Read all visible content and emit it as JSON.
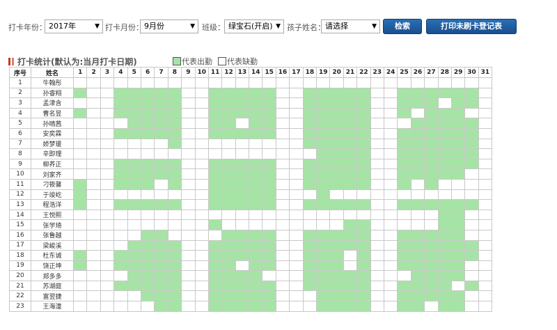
{
  "filters": {
    "year_label": "打卡年份：",
    "year_value": "2017年",
    "month_label": "打卡月份：",
    "month_value": "9月份",
    "class_label": "班级：",
    "class_value": "绿宝石(开启)",
    "child_label": "孩子姓名：",
    "child_value": "请选择",
    "search_button": "检索",
    "print_button": "打印未刷卡登记表",
    "dropdown_icon": "▼"
  },
  "section": {
    "title": "打卡统计(默认为:当月打卡日期)",
    "legend_present": "代表出勤",
    "legend_absent": "代表缺勤"
  },
  "colors": {
    "present": "#a6e4a6",
    "absent": "#ffffff",
    "button": "#1f5c9e",
    "title_accent": "#c0392b"
  },
  "table": {
    "col_index": "序号",
    "col_name": "姓名",
    "days": [
      "1",
      "2",
      "3",
      "4",
      "5",
      "6",
      "7",
      "8",
      "9",
      "10",
      "11",
      "12",
      "13",
      "14",
      "15",
      "16",
      "17",
      "18",
      "19",
      "20",
      "21",
      "22",
      "23",
      "24",
      "25",
      "26",
      "27",
      "28",
      "29",
      "30",
      "31"
    ],
    "rows": [
      {
        "no": "1",
        "name": "牛翰彤",
        "att": []
      },
      {
        "no": "2",
        "name": "孙睿翔",
        "att": [
          1,
          4,
          5,
          6,
          7,
          8,
          11,
          12,
          13,
          14,
          15,
          18,
          19,
          20,
          21,
          22,
          25,
          26,
          27,
          28,
          29,
          30
        ]
      },
      {
        "no": "3",
        "name": "孟津含",
        "att": [
          4,
          5,
          6,
          7,
          8,
          11,
          12,
          13,
          14,
          15,
          18,
          19,
          20,
          21,
          22,
          25,
          26,
          27,
          29,
          30
        ]
      },
      {
        "no": "4",
        "name": "曹名昱",
        "att": [
          1,
          4,
          5,
          6,
          7,
          8,
          11,
          12,
          13,
          14,
          15,
          18,
          19,
          20,
          21,
          22,
          25,
          27,
          28,
          29
        ]
      },
      {
        "no": "5",
        "name": "孙晴茜",
        "att": [
          5,
          6,
          7,
          8,
          11,
          12,
          14,
          15,
          18,
          19,
          20,
          21,
          22,
          26,
          27,
          28,
          29,
          30
        ]
      },
      {
        "no": "6",
        "name": "安奕霖",
        "att": [
          4,
          5,
          6,
          7,
          8,
          11,
          12,
          13,
          14,
          15,
          18,
          19,
          20,
          21,
          22,
          25,
          26,
          27,
          28,
          29,
          30
        ]
      },
      {
        "no": "7",
        "name": "娇梦瑗",
        "att": [
          8,
          18,
          19,
          20,
          21,
          22,
          25,
          26,
          27,
          28,
          29,
          30
        ]
      },
      {
        "no": "8",
        "name": "辛即理",
        "att": [
          19,
          20,
          21,
          22,
          25,
          26,
          27,
          28,
          29,
          30
        ]
      },
      {
        "no": "9",
        "name": "柳养正",
        "att": [
          4,
          5,
          6,
          7,
          8,
          11,
          12,
          13,
          14,
          15,
          18,
          19,
          20,
          21,
          22,
          25,
          26,
          27,
          28,
          29,
          30
        ]
      },
      {
        "no": "10",
        "name": "刘家齐",
        "att": [
          4,
          5,
          6,
          7,
          8,
          11,
          12,
          13,
          14,
          15,
          18,
          19,
          20,
          21,
          22,
          25,
          26,
          27,
          28,
          29
        ]
      },
      {
        "no": "11",
        "name": "刁筱馨",
        "att": [
          1,
          4,
          5,
          6,
          8,
          11,
          12,
          13,
          14,
          15,
          18,
          19,
          20,
          21,
          22,
          25,
          27
        ]
      },
      {
        "no": "12",
        "name": "于竣屹",
        "att": [
          1,
          11,
          12,
          13,
          14,
          15,
          19
        ]
      },
      {
        "no": "13",
        "name": "程浩洋",
        "att": [
          1,
          4,
          5,
          6,
          7,
          8,
          11,
          12,
          13,
          14,
          15,
          18,
          19,
          20,
          21,
          22,
          25,
          26,
          27,
          28,
          29,
          30
        ]
      },
      {
        "no": "14",
        "name": "王悦熙",
        "att": [
          28,
          29
        ]
      },
      {
        "no": "15",
        "name": "张学琦",
        "att": [
          11,
          21,
          22,
          28,
          29
        ]
      },
      {
        "no": "16",
        "name": "张鲁越",
        "att": [
          6,
          7,
          12,
          13,
          14,
          15,
          18,
          19,
          20,
          21,
          22,
          25,
          26,
          27,
          28,
          29
        ]
      },
      {
        "no": "17",
        "name": "梁峻溪",
        "att": [
          5,
          6,
          7,
          8,
          11,
          12,
          13,
          14,
          15,
          18,
          19,
          20,
          21,
          22,
          25,
          26,
          27,
          28,
          29,
          30
        ]
      },
      {
        "no": "18",
        "name": "杜东诚",
        "att": [
          1,
          4,
          5,
          6,
          7,
          8,
          11,
          12,
          13,
          14,
          15,
          18,
          19,
          20,
          22,
          25,
          26,
          27,
          28,
          29,
          30
        ]
      },
      {
        "no": "19",
        "name": "饶正坤",
        "att": [
          1,
          4,
          5,
          6,
          7,
          8,
          11,
          12,
          14,
          15,
          18,
          19,
          20,
          22,
          25,
          26,
          27,
          28,
          29
        ]
      },
      {
        "no": "20",
        "name": "郑多多",
        "att": [
          5,
          6,
          7,
          8,
          11,
          12,
          13,
          14,
          18,
          19,
          20,
          21,
          22,
          26,
          27,
          28,
          29
        ]
      },
      {
        "no": "21",
        "name": "苏湖庭",
        "att": [
          4,
          5,
          6,
          7,
          8,
          11,
          12,
          13,
          14,
          15,
          18,
          19,
          20,
          21,
          22,
          25,
          26,
          27,
          28,
          30
        ]
      },
      {
        "no": "22",
        "name": "富翌捷",
        "att": [
          6,
          7,
          8,
          11,
          12,
          13,
          14,
          15,
          19,
          20,
          21,
          22,
          25,
          26,
          27,
          28,
          29
        ]
      },
      {
        "no": "23",
        "name": "王海潼",
        "att": [
          7,
          8,
          11,
          12,
          13,
          14,
          15,
          19,
          20,
          21,
          22,
          25,
          26,
          28,
          29
        ]
      }
    ]
  }
}
